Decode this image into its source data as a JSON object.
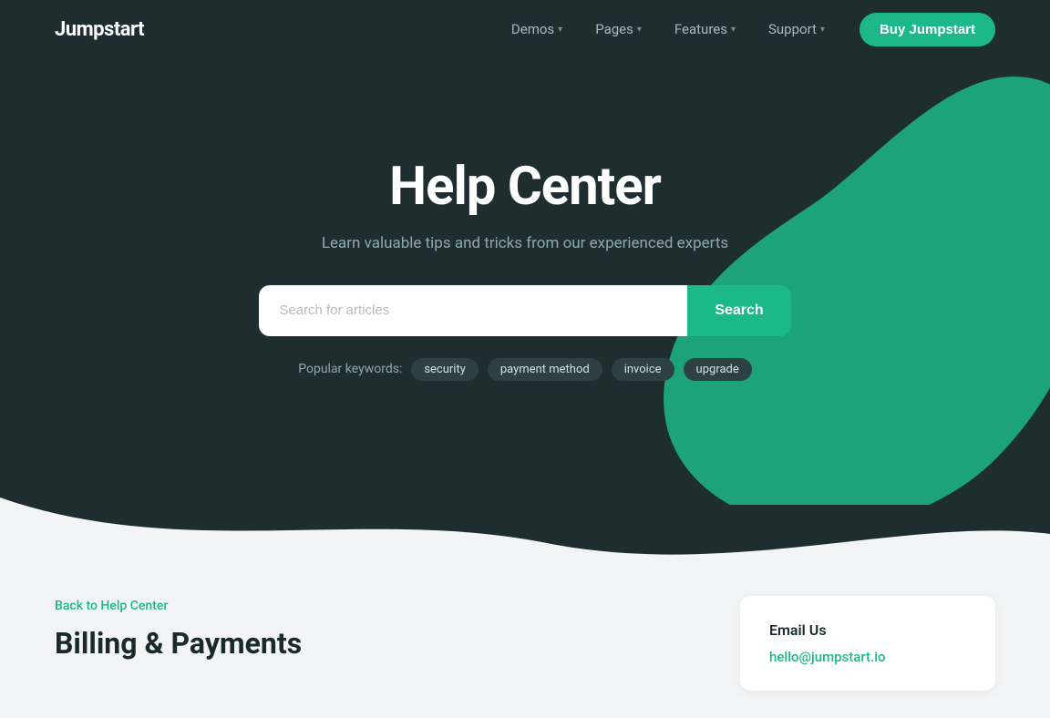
{
  "brand": "Jumpstart",
  "nav": {
    "items": [
      {
        "label": "Demos",
        "has_dropdown": true
      },
      {
        "label": "Pages",
        "has_dropdown": true
      },
      {
        "label": "Features",
        "has_dropdown": true
      },
      {
        "label": "Support",
        "has_dropdown": true
      }
    ],
    "cta_label": "Buy Jumpstart"
  },
  "hero": {
    "title": "Help Center",
    "subtitle": "Learn valuable tips and tricks from our experienced experts",
    "search_placeholder": "Search for articles",
    "search_button_label": "Search",
    "popular_label": "Popular keywords:",
    "keywords": [
      "security",
      "payment method",
      "invoice",
      "upgrade"
    ]
  },
  "below": {
    "back_link": "Back to Help Center",
    "page_title": "Billing & Payments",
    "sidebar": {
      "email_section_title": "Email Us",
      "email": "hello@jumpstart.io"
    }
  }
}
